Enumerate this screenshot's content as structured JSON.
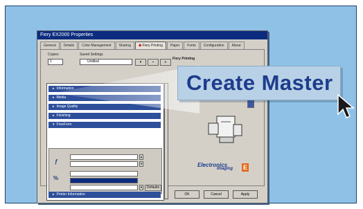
{
  "window": {
    "title": "Fiery EX2000 Properties",
    "tabs": [
      {
        "label": "General"
      },
      {
        "label": "Details"
      },
      {
        "label": "Color Management"
      },
      {
        "label": "Sharing"
      },
      {
        "label": "Fiery Printing",
        "active": true
      },
      {
        "label": "Paper"
      },
      {
        "label": "Fonts"
      },
      {
        "label": "Configuration"
      },
      {
        "label": "About"
      }
    ]
  },
  "form": {
    "copies_label": "Copies",
    "copies_value": "1",
    "saved_settings_label": "Saved Settings",
    "saved_settings_value": "Untitled"
  },
  "sections": [
    {
      "label": "Information"
    },
    {
      "label": "Media"
    },
    {
      "label": "Image Quality"
    },
    {
      "label": "Finishing"
    },
    {
      "label": "FreeForm"
    }
  ],
  "bottom_section": {
    "label": "Printer Information"
  },
  "right_panel": {
    "header": "Fiery Printing",
    "logo_main": "Electronics",
    "logo_sub": "Imaging",
    "logo_badge": "E"
  },
  "buttons": {
    "ok": "OK",
    "cancel": "Cancel",
    "apply": "Apply",
    "defaults": "Defaults"
  },
  "callout": {
    "text": "Create Master"
  },
  "colors": {
    "backdrop": "#8fc1e6",
    "title_bar": "#0c2c7f",
    "section_bar": "#2e4f9a",
    "callout_text": "#1e3c8c"
  },
  "icons": {
    "cursor": "mouse-pointer-icon",
    "row1": "fx-icon",
    "row2": "percent-icon"
  }
}
